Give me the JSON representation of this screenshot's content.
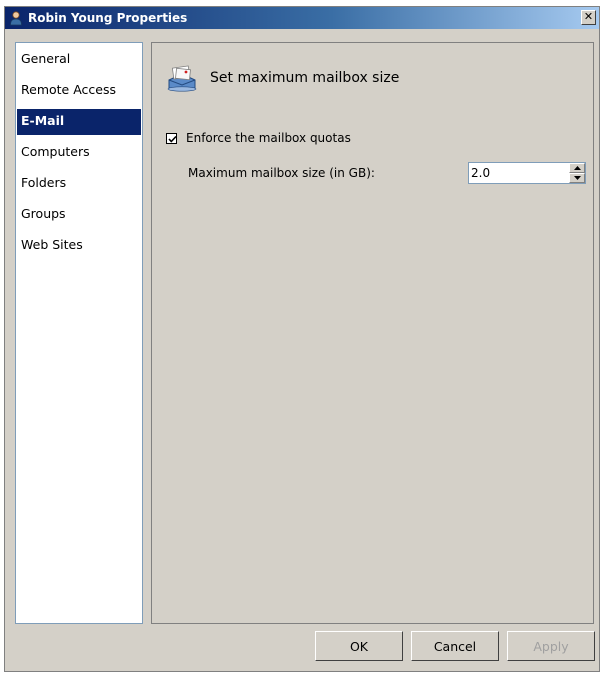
{
  "window": {
    "title": "Robin Young Properties",
    "close_glyph": "✕",
    "title_icon": "user-icon"
  },
  "nav": {
    "items": [
      {
        "label": "General",
        "selected": false
      },
      {
        "label": "Remote Access",
        "selected": false
      },
      {
        "label": "E-Mail",
        "selected": true
      },
      {
        "label": "Computers",
        "selected": false
      },
      {
        "label": "Folders",
        "selected": false
      },
      {
        "label": "Groups",
        "selected": false
      },
      {
        "label": "Web Sites",
        "selected": false
      }
    ]
  },
  "content": {
    "section_icon": "mailbox-icon",
    "section_title": "Set maximum mailbox size",
    "enforce_checkbox": {
      "label": "Enforce the mailbox quotas",
      "checked": true
    },
    "max_size": {
      "label": "Maximum mailbox size (in GB):",
      "value": "2.0"
    }
  },
  "buttons": {
    "ok": "OK",
    "cancel": "Cancel",
    "apply": "Apply"
  },
  "colors": {
    "title_gradient_start": "#0a246a",
    "title_gradient_end": "#a6caf0",
    "selection": "#0a246a",
    "dialog_face": "#d4d0c8"
  }
}
